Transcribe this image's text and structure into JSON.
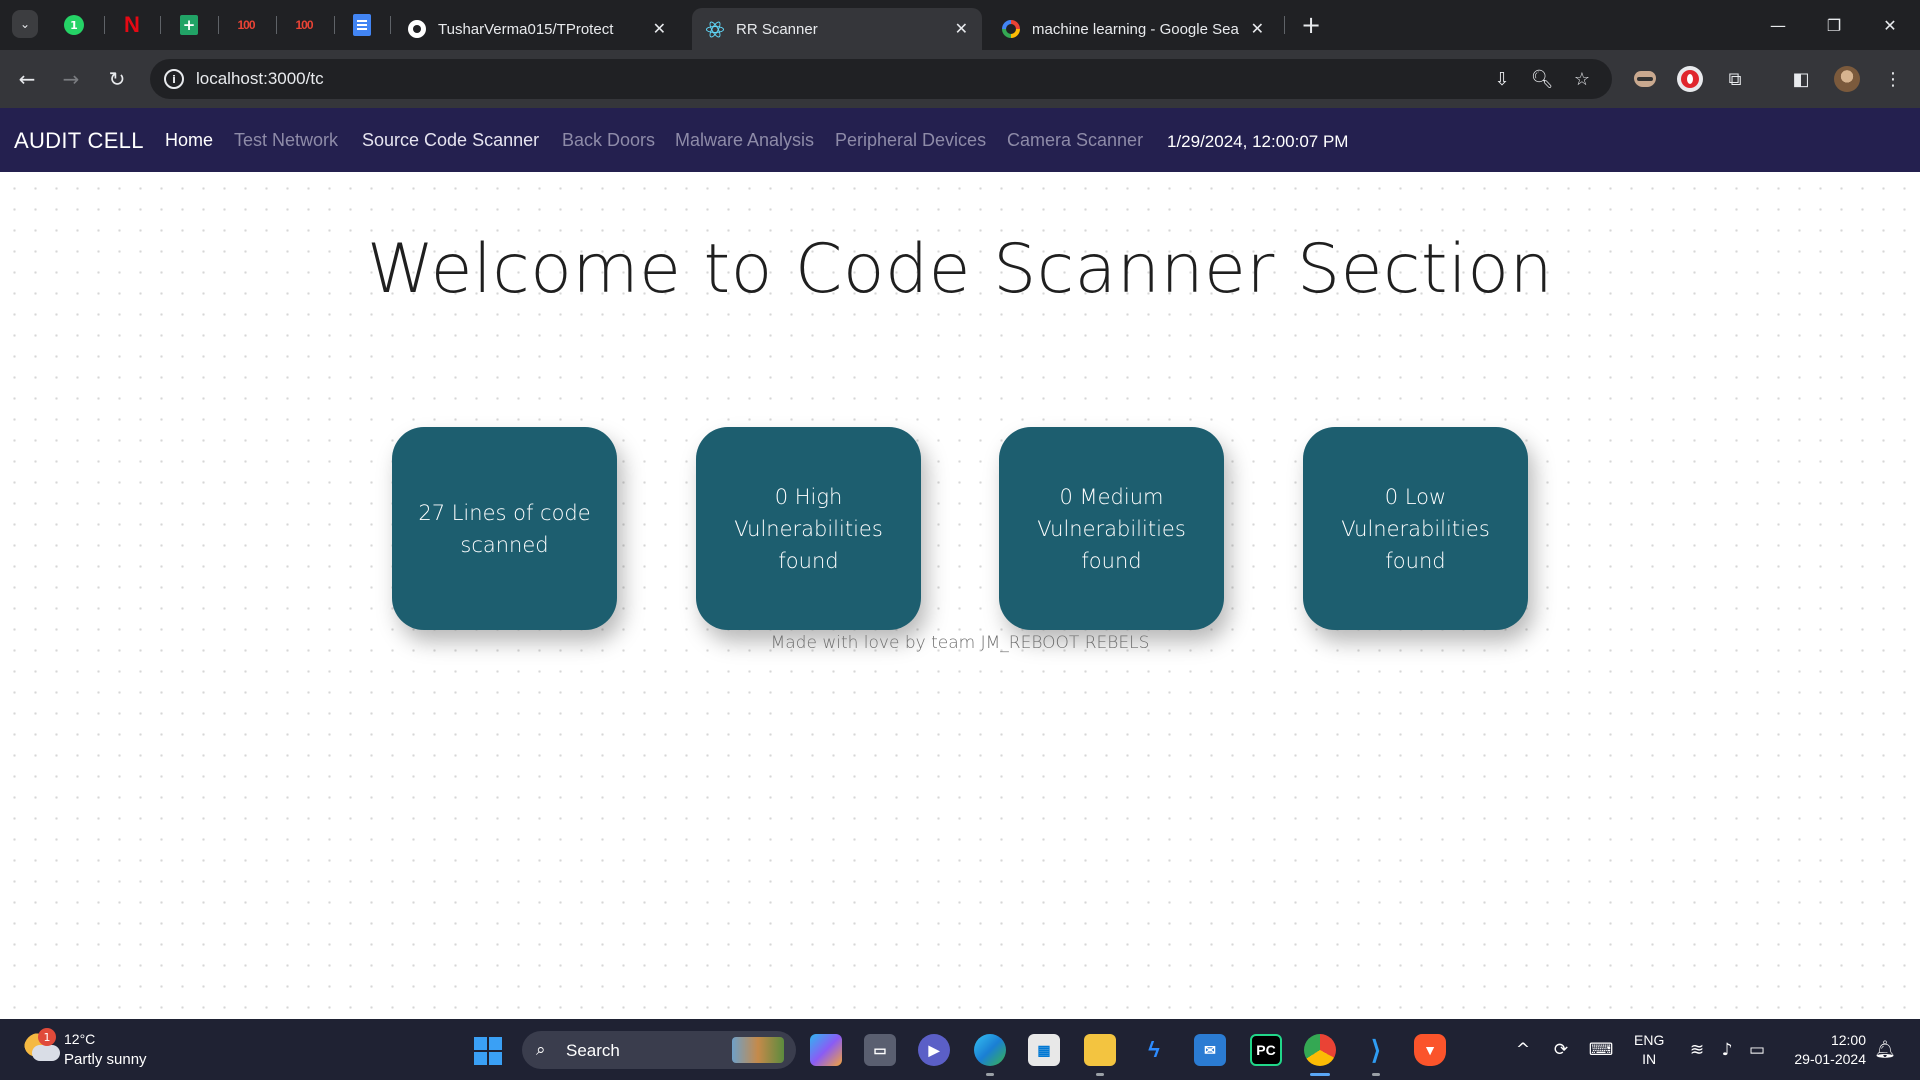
{
  "browser": {
    "tabs": [
      {
        "title": "TusharVerma015/TProtect",
        "icon": "github-icon",
        "active": false
      },
      {
        "title": "RR Scanner",
        "icon": "react-icon",
        "active": true
      },
      {
        "title": "machine learning - Google Sea",
        "icon": "google-icon",
        "active": false
      }
    ],
    "pinned_tabs": [
      "whatsapp-icon",
      "netflix-icon",
      "google-sheets-icon",
      "hundred-icon",
      "hundred-icon",
      "google-docs-icon"
    ],
    "pinned_glyphs": {
      "whatsapp": "1",
      "netflix": "N",
      "sheets": "+",
      "hundred": "100"
    },
    "address_url": "localhost:3000/tc"
  },
  "app": {
    "brand": "AUDIT CELL",
    "nav": [
      {
        "label": "Home"
      },
      {
        "label": "Test Network"
      },
      {
        "label": "Source Code Scanner"
      },
      {
        "label": "Back Doors"
      },
      {
        "label": "Malware Analysis"
      },
      {
        "label": "Peripheral Devices"
      },
      {
        "label": "Camera Scanner"
      }
    ],
    "datetime": "1/29/2024, 12:00:07 PM",
    "nav_bg": "#24204f",
    "card_color": "#1d5e6f"
  },
  "main": {
    "heading": "Welcome to Code Scanner Section",
    "cards": [
      {
        "label": "27 Lines of code scanned"
      },
      {
        "label": "0 High Vulnerabilities found"
      },
      {
        "label": "0 Medium Vulnerabilities found"
      },
      {
        "label": "0 Low Vulnerabilities found"
      }
    ],
    "footer": "Made with love by team JM_REBOOT REBELS"
  },
  "taskbar": {
    "weather": {
      "badge": "1",
      "temp": "12°C",
      "condition": "Partly sunny"
    },
    "search_label": "Search",
    "language": {
      "line1": "ENG",
      "line2": "IN"
    },
    "clock": {
      "time": "12:00",
      "date": "29-01-2024"
    },
    "apps": [
      "copilot-icon",
      "task-view-icon",
      "teams-chat-icon",
      "edge-icon",
      "microsoft-store-icon",
      "file-explorer-icon",
      "power-automate-icon",
      "mail-icon",
      "pycharm-icon",
      "chrome-icon",
      "vscode-icon",
      "brave-icon"
    ],
    "app_glyphs": {
      "pycharm": "PC"
    }
  }
}
